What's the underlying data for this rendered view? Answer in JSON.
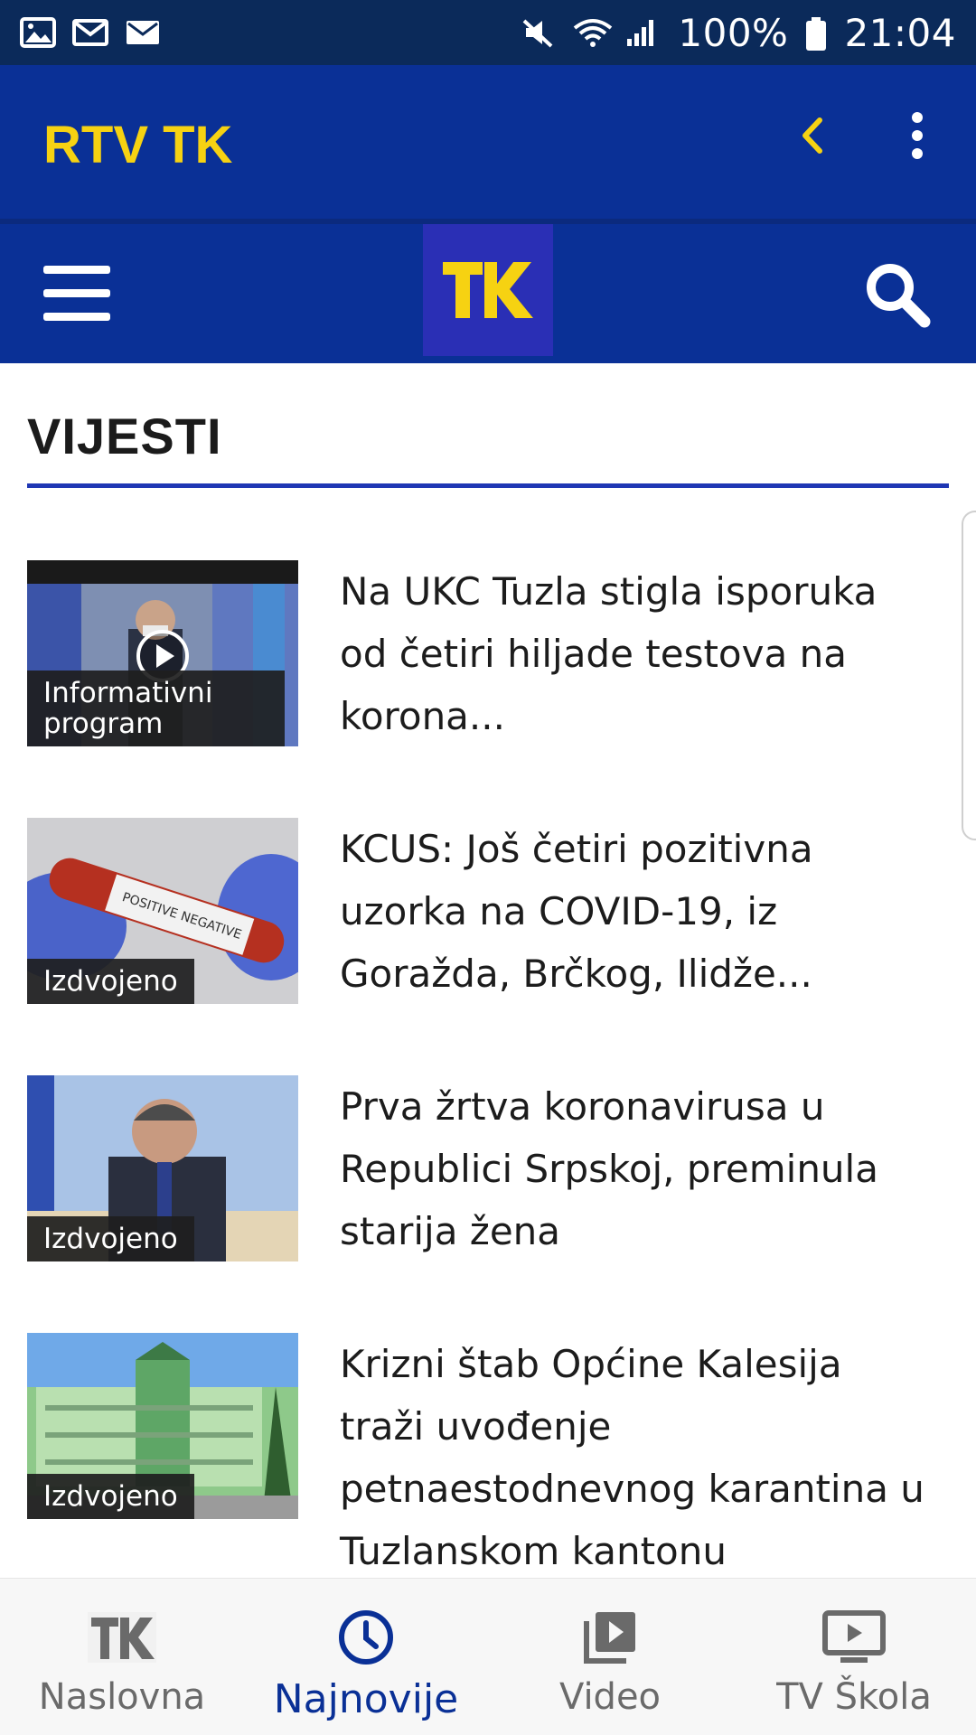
{
  "status_bar": {
    "battery": "100%",
    "time": "21:04",
    "icons": [
      "image-icon",
      "mail-icon",
      "mail-filled-icon",
      "mute-icon",
      "wifi-icon",
      "signal-icon",
      "battery-icon"
    ]
  },
  "app_bar": {
    "title": "RTV TK",
    "icons": [
      "back-chevron-icon",
      "more-vert-icon"
    ]
  },
  "sub_bar": {
    "logo_text": "TK",
    "icons": [
      "hamburger-menu-icon",
      "search-icon"
    ]
  },
  "section": {
    "title": "VIJESTI"
  },
  "news": [
    {
      "category": "Informativni program",
      "headline": "Na UKC Tuzla stigla isporuka od četiri hiljade testova na korona...",
      "has_video": true
    },
    {
      "category": "Izdvojeno",
      "headline": "KCUS: Još četiri pozitivna uzorka na COVID-19, iz Goražda, Brčkog, Ilidže...",
      "has_video": false
    },
    {
      "category": "Izdvojeno",
      "headline": "Prva žrtva koronavirusa u Republici Srpskoj, preminula starija žena",
      "has_video": false
    },
    {
      "category": "Izdvojeno",
      "headline": "Krizni štab Općine Kalesija traži uvođenje petnaestodnevnog karantina u Tuzlanskom kantonu",
      "has_video": false
    }
  ],
  "bottom_nav": [
    {
      "label": "Naslovna",
      "icon": "tk-logo-icon",
      "active": false
    },
    {
      "label": "Najnovije",
      "icon": "clock-icon",
      "active": true
    },
    {
      "label": "Video",
      "icon": "video-library-icon",
      "active": false
    },
    {
      "label": "TV Škola",
      "icon": "tv-play-icon",
      "active": false
    }
  ],
  "colors": {
    "status_bar": "#0b2a5a",
    "app_bar": "#0a3096",
    "accent_yellow": "#f6d212",
    "logo_bg": "#2a2fb5",
    "rule": "#1f37b4",
    "nav_active": "#0a3096",
    "nav_inactive": "#6a6a6a"
  }
}
